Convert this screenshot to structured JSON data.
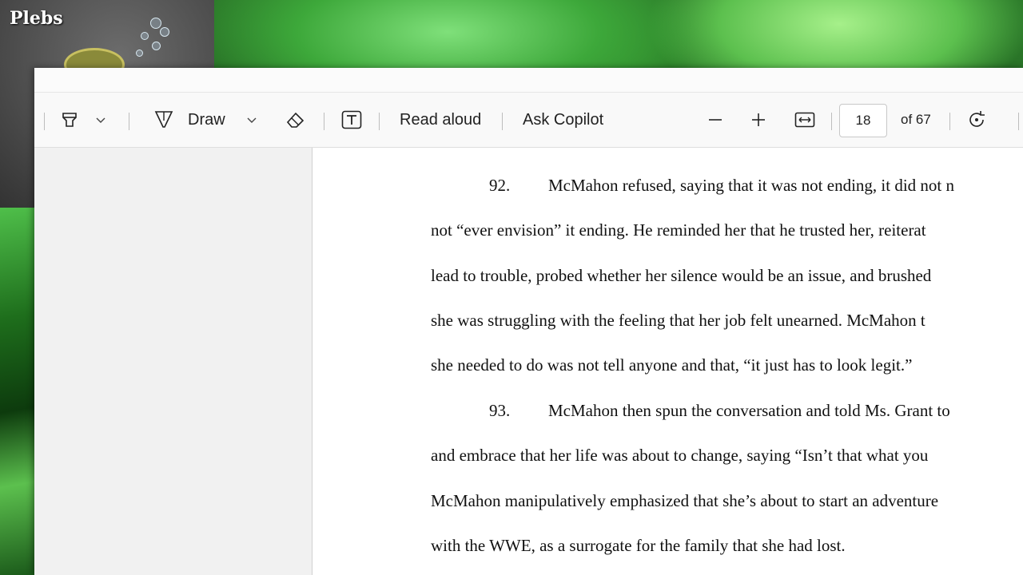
{
  "overlay": {
    "logo_text": "Plebs"
  },
  "toolbar": {
    "draw_label": "Draw",
    "read_aloud_label": "Read aloud",
    "ask_copilot_label": "Ask Copilot",
    "page_number": "18",
    "page_total": "of 67"
  },
  "document": {
    "paragraphs": [
      {
        "number": "92.",
        "first_line": "McMahon refused, saying that it was not ending, it did not n",
        "lines": [
          "not “ever envision” it ending.  He reminded her that he trusted her, reiterat",
          "lead to trouble, probed whether her silence would be an issue, and brushed",
          "she was struggling with the feeling that her job felt unearned.  McMahon t",
          "she needed to do was not tell anyone and that, “it just has to look legit.”"
        ]
      },
      {
        "number": "93.",
        "first_line": "McMahon then spun the conversation and told Ms. Grant to",
        "lines": [
          "and embrace that her life was about to change, saying “Isn’t that what you",
          "McMahon manipulatively emphasized that she’s about to start an adventure",
          "with the WWE, as a surrogate for the family that she had lost."
        ]
      }
    ]
  }
}
